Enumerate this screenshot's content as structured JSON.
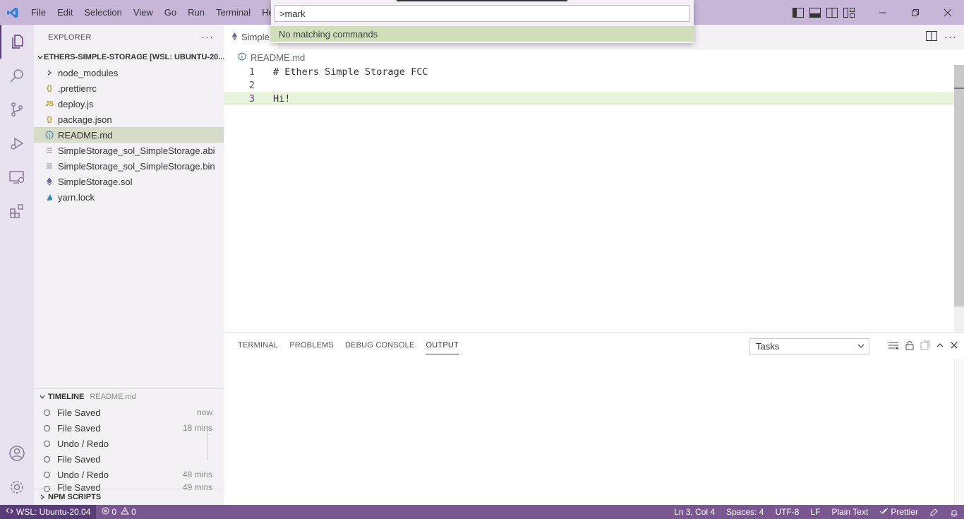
{
  "menu": [
    "File",
    "Edit",
    "Selection",
    "View",
    "Go",
    "Run",
    "Terminal",
    "Hel"
  ],
  "palette": {
    "query": ">mark",
    "result": "No matching commands"
  },
  "sidebar": {
    "title": "EXPLORER",
    "folder": "ETHERS-SIMPLE-STORAGE [WSL: UBUNTU-20....",
    "files": [
      {
        "name": "node_modules",
        "icon": "folder-chevron",
        "type": "folder"
      },
      {
        "name": ".prettierrc",
        "icon": "{}",
        "type": "json"
      },
      {
        "name": "deploy.js",
        "icon": "JS",
        "type": "js"
      },
      {
        "name": "package.json",
        "icon": "{}",
        "type": "json"
      },
      {
        "name": "README.md",
        "icon": "info",
        "type": "md",
        "selected": true
      },
      {
        "name": "SimpleStorage_sol_SimpleStorage.abi",
        "icon": "lines",
        "type": "text"
      },
      {
        "name": "SimpleStorage_sol_SimpleStorage.bin",
        "icon": "lines",
        "type": "text"
      },
      {
        "name": "SimpleStorage.sol",
        "icon": "eth",
        "type": "sol"
      },
      {
        "name": "yarn.lock",
        "icon": "yarn",
        "type": "yarn"
      }
    ],
    "timeline": {
      "title": "TIMELINE",
      "file": "README.md",
      "items": [
        {
          "label": "File Saved",
          "time": "now"
        },
        {
          "label": "File Saved",
          "time": "18 mins"
        },
        {
          "label": "Undo / Redo",
          "time": ""
        },
        {
          "label": "File Saved",
          "time": ""
        },
        {
          "label": "Undo / Redo",
          "time": "48 mins"
        },
        {
          "label": "File Saved",
          "time": "49 mins"
        }
      ]
    },
    "npm_scripts": "NPM SCRIPTS"
  },
  "editor": {
    "tab_label": "Simple",
    "breadcrumb": "README.md",
    "lines": [
      {
        "num": "1",
        "text": "# Ethers Simple Storage FCC"
      },
      {
        "num": "2",
        "text": ""
      },
      {
        "num": "3",
        "text": "Hi!"
      }
    ]
  },
  "panel": {
    "tabs": [
      "TERMINAL",
      "PROBLEMS",
      "DEBUG CONSOLE",
      "OUTPUT"
    ],
    "active_tab": "OUTPUT",
    "select_value": "Tasks"
  },
  "status": {
    "remote": "WSL: Ubuntu-20.04",
    "errors": "0",
    "warnings": "0",
    "position": "Ln 3, Col 4",
    "spaces": "Spaces: 4",
    "encoding": "UTF-8",
    "eol": "LF",
    "language": "Plain Text",
    "prettier": "Prettier"
  },
  "colors": {
    "titlebar": "#c8b6d8",
    "statusbar": "#7a5790",
    "accent": "#5a3b7a",
    "selection": "#d4dcc8"
  }
}
